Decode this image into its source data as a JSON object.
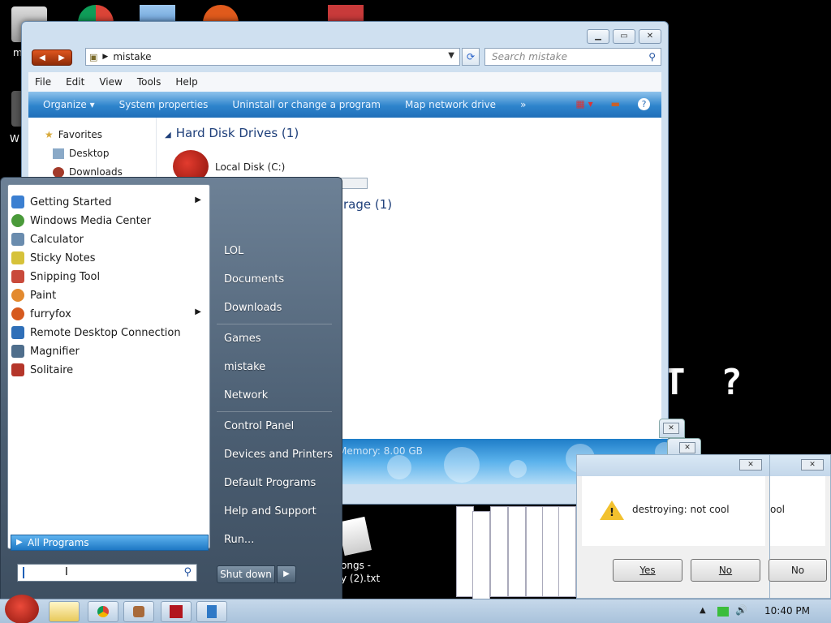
{
  "explorer": {
    "address": "mistake",
    "search_placeholder": "Search mistake",
    "menus": [
      "File",
      "Edit",
      "View",
      "Tools",
      "Help"
    ],
    "toolbar": [
      "Organize ▾",
      "System properties",
      "Uninstall or change a program",
      "Map network drive",
      "»"
    ],
    "nav": {
      "favorites": "Favorites",
      "desktop": "Desktop",
      "downloads": "Downloads"
    },
    "hard_disks_header": "Hard Disk Drives (1)",
    "drive_label": "Local Disk (C:)",
    "drive_usage_fraction": 0.28,
    "storage_header": "rage (1)",
    "memory_text": "Memory: 8.00 GB"
  },
  "start_menu": {
    "programs": [
      {
        "label": "Getting Started",
        "submenu": true,
        "color": "#3b7fd1"
      },
      {
        "label": "Windows Media Center",
        "submenu": false,
        "color": "#4a9a3a"
      },
      {
        "label": "Calculator",
        "submenu": false,
        "color": "#6a8cae"
      },
      {
        "label": "Sticky Notes",
        "submenu": false,
        "color": "#d6c23a"
      },
      {
        "label": "Snipping Tool",
        "submenu": false,
        "color": "#c94a3b"
      },
      {
        "label": "Paint",
        "submenu": false,
        "color": "#e38a2f"
      },
      {
        "label": "furryfox",
        "submenu": true,
        "color": "#d65a1f"
      },
      {
        "label": "Remote Desktop Connection",
        "submenu": false,
        "color": "#2f6fb8"
      },
      {
        "label": "Magnifier",
        "submenu": false,
        "color": "#4f6e8c"
      },
      {
        "label": "Solitaire",
        "submenu": false,
        "color": "#b5362a"
      }
    ],
    "all_programs": "All Programs",
    "right_items": [
      "LOL",
      "Documents",
      "Downloads",
      "Games",
      "mistake",
      "Network",
      "Control Panel",
      "Devices and Printers",
      "Default Programs",
      "Help and Support",
      "Run..."
    ],
    "shutdown": "Shut down"
  },
  "desktop": {
    "pixel_text_1": "T",
    "pixel_text_2": "?",
    "label_m": "m",
    "label_w": "W",
    "file_label_1": "ongs -",
    "file_label_2": "y (2).txt"
  },
  "dialog": {
    "message": "destroying: not cool",
    "message_2": "ool",
    "yes": "Yes",
    "no": "No",
    "no_2": "No"
  },
  "taskbar": {
    "clock": "10:40 PM"
  }
}
